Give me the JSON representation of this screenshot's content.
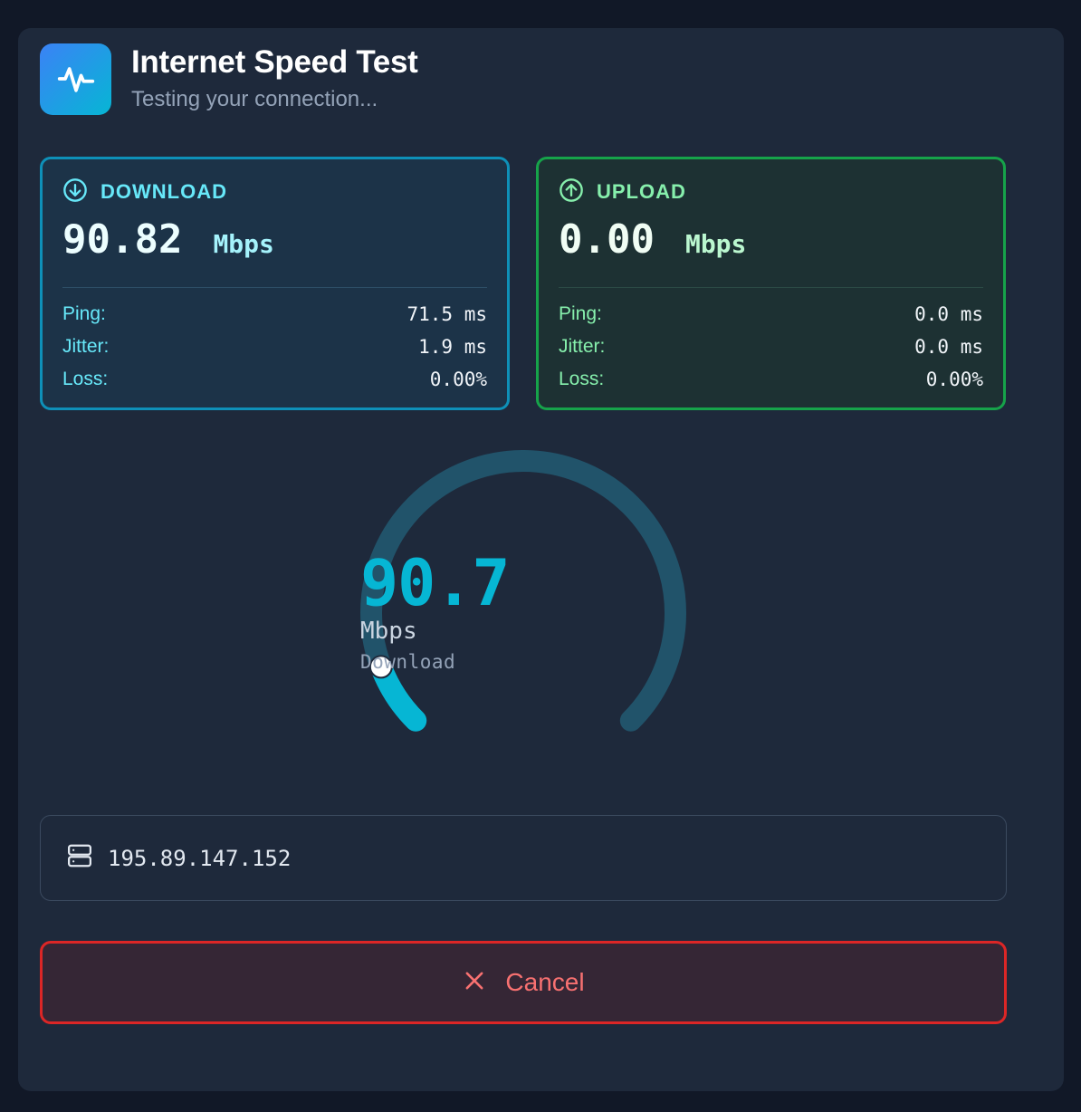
{
  "header": {
    "icon": "activity-pulse-icon",
    "title": "Internet Speed Test",
    "subtitle": "Testing your connection..."
  },
  "download": {
    "icon": "arrow-down-circle-icon",
    "label": "DOWNLOAD",
    "speed": "90.82",
    "unit": "Mbps",
    "metrics": [
      {
        "label": "Ping:",
        "value": "71.5 ms"
      },
      {
        "label": "Jitter:",
        "value": "1.9 ms"
      },
      {
        "label": "Loss:",
        "value": "0.00%"
      }
    ]
  },
  "upload": {
    "icon": "arrow-up-circle-icon",
    "label": "UPLOAD",
    "speed": "0.00",
    "unit": "Mbps",
    "metrics": [
      {
        "label": "Ping:",
        "value": "0.0 ms"
      },
      {
        "label": "Jitter:",
        "value": "0.0 ms"
      },
      {
        "label": "Loss:",
        "value": "0.00%"
      }
    ]
  },
  "gauge": {
    "value": "90.7",
    "unit": "Mbps",
    "mode": "Download",
    "progress_fraction": 0.09
  },
  "server": {
    "icon": "server-icon",
    "address": "195.89.147.152"
  },
  "cancel_button": {
    "icon": "close-x-icon",
    "label": "Cancel"
  },
  "colors": {
    "background": "#111827",
    "card": "#1e293b",
    "download_accent": "#06b6d4",
    "upload_accent": "#22c55e",
    "cancel_accent": "#dc2626",
    "gauge_track": "#21536a"
  }
}
